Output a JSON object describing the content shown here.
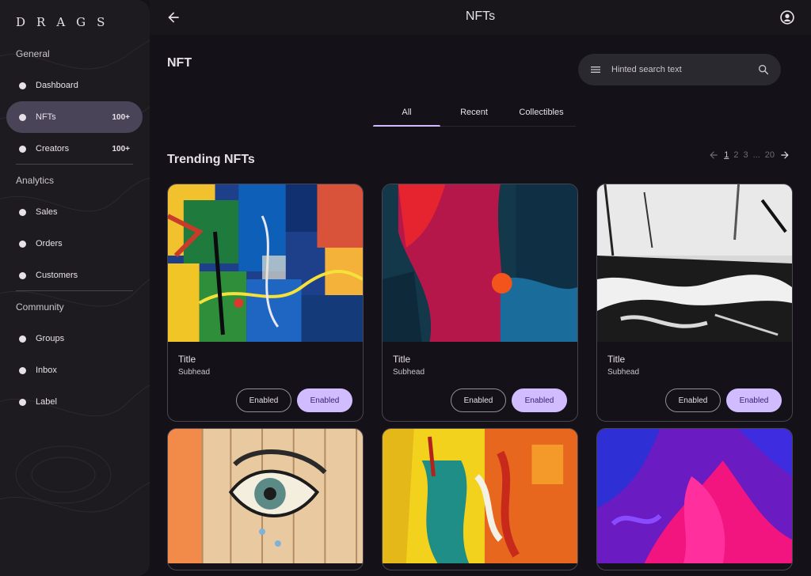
{
  "sidebar": {
    "logo": "DRAGS",
    "sections": [
      {
        "title": "General"
      },
      {
        "title": "Analytics"
      },
      {
        "title": "Community"
      }
    ],
    "items": [
      {
        "label": "Dashboard",
        "badge": ""
      },
      {
        "label": "NFTs",
        "badge": "100+"
      },
      {
        "label": "Creators",
        "badge": "100+"
      },
      {
        "label": "Sales",
        "badge": ""
      },
      {
        "label": "Orders",
        "badge": ""
      },
      {
        "label": "Customers",
        "badge": ""
      },
      {
        "label": "Groups",
        "badge": ""
      },
      {
        "label": "Inbox",
        "badge": ""
      },
      {
        "label": "Label",
        "badge": ""
      }
    ]
  },
  "topbar": {
    "title": "NFTs"
  },
  "main": {
    "heading": "NFT",
    "search": {
      "placeholder": "Hinted search text"
    },
    "tabs": [
      {
        "label": "All"
      },
      {
        "label": "Recent"
      },
      {
        "label": "Collectibles"
      }
    ],
    "active_tab": "All",
    "section_heading": "Trending NFTs",
    "pager": {
      "pages": [
        "1",
        "2",
        "3"
      ],
      "ellipsis": "...",
      "last": "20",
      "current": "1"
    },
    "cards": [
      {
        "title": "Title",
        "subhead": "Subhead",
        "outline_label": "Enabled",
        "filled_label": "Enabled"
      },
      {
        "title": "Title",
        "subhead": "Subhead",
        "outline_label": "Enabled",
        "filled_label": "Enabled"
      },
      {
        "title": "Title",
        "subhead": "Subhead",
        "outline_label": "Enabled",
        "filled_label": "Enabled"
      }
    ]
  },
  "colors": {
    "background": "#141218",
    "surface": "#1D1B20",
    "active_nav": "#4A4458",
    "primary": "#D0BCFF",
    "on_primary": "#381E72"
  },
  "icons": {
    "back": "arrow-left-icon",
    "account": "account-circle-icon",
    "menu": "menu-icon",
    "search": "search-icon",
    "prev": "arrow-left-icon",
    "next": "arrow-right-icon"
  }
}
